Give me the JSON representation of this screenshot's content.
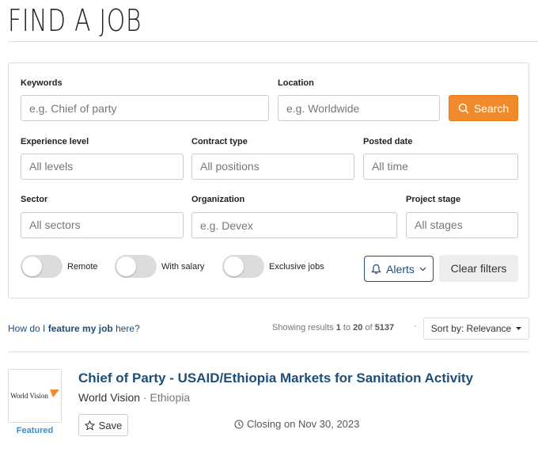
{
  "page": {
    "title": "FIND A JOB"
  },
  "filters": {
    "keywords": {
      "label": "Keywords",
      "placeholder": "e.g. Chief of party"
    },
    "location": {
      "label": "Location",
      "placeholder": "e.g. Worldwide"
    },
    "search_label": "Search",
    "experience": {
      "label": "Experience level",
      "value": "All levels"
    },
    "contract": {
      "label": "Contract type",
      "value": "All positions"
    },
    "posted": {
      "label": "Posted date",
      "value": "All time"
    },
    "sector": {
      "label": "Sector",
      "value": "All sectors"
    },
    "organization": {
      "label": "Organization",
      "placeholder": "e.g. Devex"
    },
    "stage": {
      "label": "Project stage",
      "value": "All stages"
    },
    "toggles": {
      "remote": "Remote",
      "salary": "With salary",
      "exclusive": "Exclusive jobs"
    },
    "alerts_label": "Alerts",
    "clear_label": "Clear filters"
  },
  "results_bar": {
    "feature_prefix": "How do I ",
    "feature_bold": "feature my job",
    "feature_suffix": " here?",
    "showing_prefix": "Showing results ",
    "start": "1",
    "to": " to ",
    "end": "20",
    "of": " of ",
    "total": "5137",
    "separator": "·",
    "sort_label": "Sort by: Relevance"
  },
  "jobs": [
    {
      "title": "Chief of Party - USAID/Ethiopia Markets for Sanitation Activity",
      "organization": "World Vision",
      "separator": " · ",
      "country": "Ethiopia",
      "logo_text": "World Vision",
      "badge": "Featured",
      "save_label": "Save",
      "closing": "Closing on Nov 30, 2023"
    }
  ],
  "colors": {
    "accent": "#f18a2b",
    "link": "#1f4e79",
    "featured": "#3a8fc7"
  },
  "icons": [
    "search-icon",
    "bell-icon",
    "chevron-down-icon",
    "caret-down-icon",
    "star-icon",
    "clock-icon"
  ]
}
